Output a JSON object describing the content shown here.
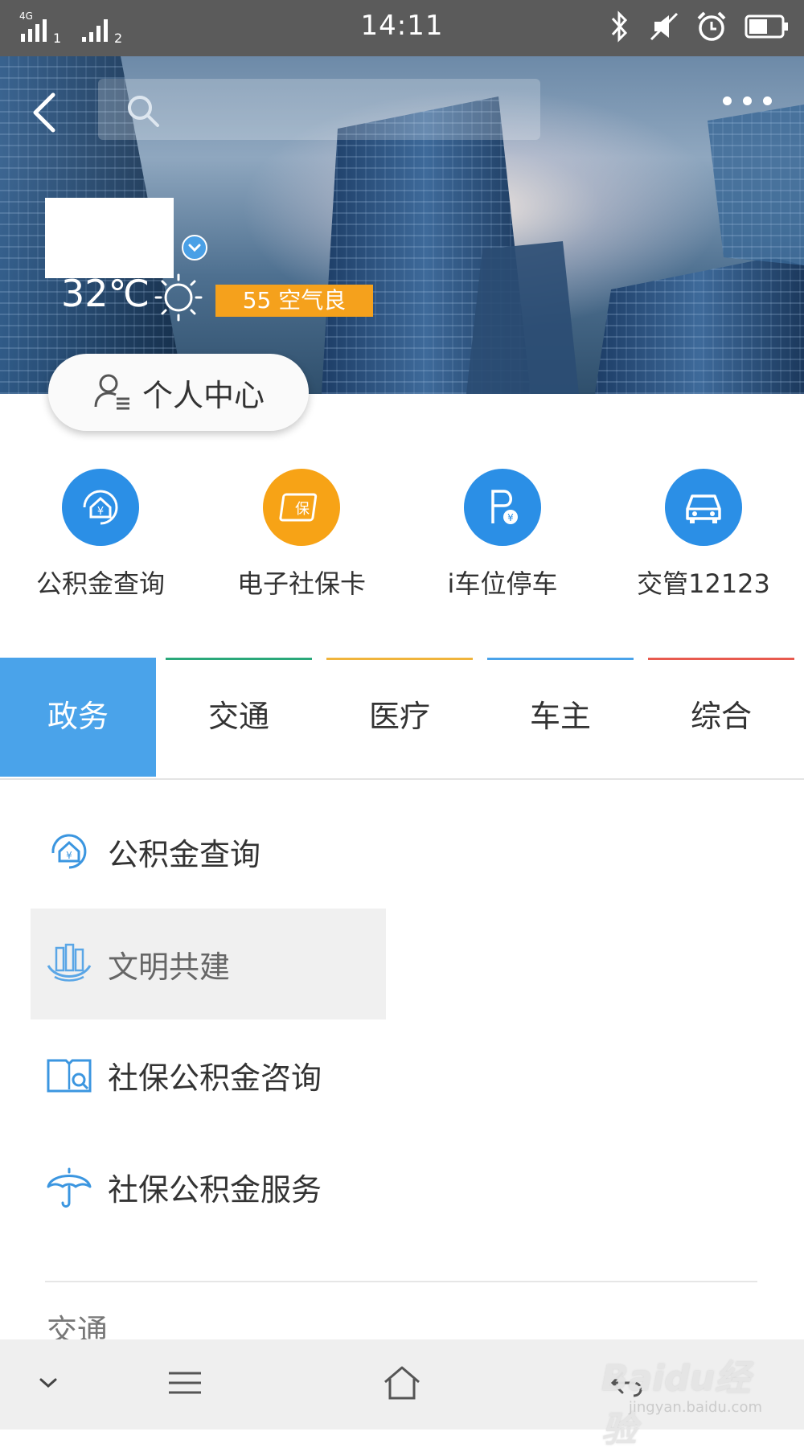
{
  "status_bar": {
    "time": "14:11",
    "sim1_label": "1",
    "sim2_label": "2",
    "network": "4G",
    "icons": [
      "bluetooth-icon",
      "mute-icon",
      "alarm-icon",
      "battery-icon"
    ]
  },
  "header": {
    "back_icon": "back-arrow-icon",
    "search_icon": "search-icon",
    "search_placeholder": "",
    "more_icon": "more-dots-icon"
  },
  "weather": {
    "temperature": "32℃",
    "condition_icon": "sun-icon",
    "aqi_text": "55 空气良",
    "aqi_color": "#f5a11c"
  },
  "personal_center": {
    "label": "个人中心",
    "icon": "user-list-icon"
  },
  "quick_services": [
    {
      "label": "公积金查询",
      "icon": "housing-fund-icon",
      "color": "#2b8fe6"
    },
    {
      "label": "电子社保卡",
      "icon": "insurance-card-icon",
      "color": "#f7a316"
    },
    {
      "label": "i车位停车",
      "icon": "parking-icon",
      "color": "#2b8fe6"
    },
    {
      "label": "交管12123",
      "icon": "car-icon",
      "color": "#2b8fe6"
    }
  ],
  "tabs": [
    {
      "label": "政务",
      "active": true,
      "color": "#4aa3ea"
    },
    {
      "label": "交通",
      "active": false,
      "color": "#2aa87a"
    },
    {
      "label": "医疗",
      "active": false,
      "color": "#f0b43c"
    },
    {
      "label": "车主",
      "active": false,
      "color": "#4aa3ea"
    },
    {
      "label": "综合",
      "active": false,
      "color": "#e85a4f"
    }
  ],
  "services": [
    {
      "label": "公积金查询",
      "icon": "housing-fund-outline-icon"
    },
    {
      "label": "文明共建",
      "icon": "civilization-building-icon",
      "highlighted": true
    },
    {
      "label": "社保公积金咨询",
      "icon": "book-search-icon"
    },
    {
      "label": "社保公积金服务",
      "icon": "umbrella-icon"
    }
  ],
  "next_section": {
    "label": "交通"
  },
  "bottom_nav": {
    "icons": [
      "chevron-down-icon",
      "menu-icon",
      "home-icon",
      "back-icon"
    ]
  },
  "watermark": {
    "line1": "Baidu经验",
    "line2": "jingyan.baidu.com"
  }
}
